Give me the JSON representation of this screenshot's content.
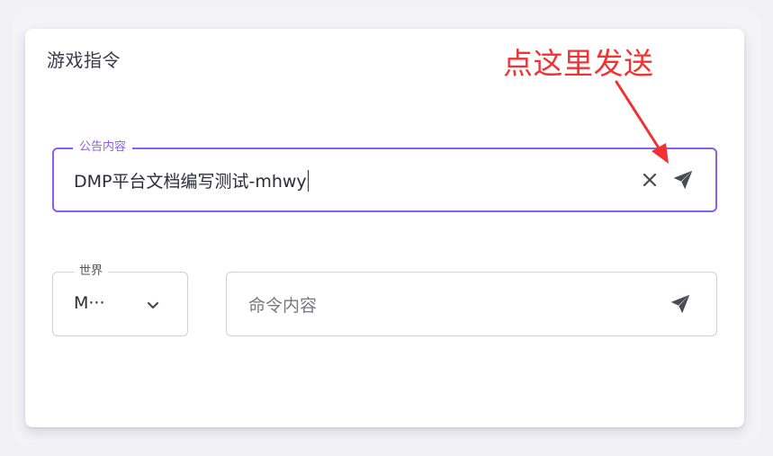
{
  "card": {
    "title": "游戏指令"
  },
  "announcement": {
    "label": "公告内容",
    "value": "DMP平台文档编写测试-mhwy"
  },
  "world": {
    "label": "世界",
    "value": "M···"
  },
  "command": {
    "placeholder": "命令内容"
  },
  "annotation": {
    "text": "点这里发送"
  },
  "colors": {
    "accent": "#8b5cf6",
    "annotation": "#f03232",
    "icon": "#4a4a55"
  },
  "icons": {
    "clear": "close-icon",
    "send": "send-icon",
    "dropdown": "chevron-down-icon"
  }
}
